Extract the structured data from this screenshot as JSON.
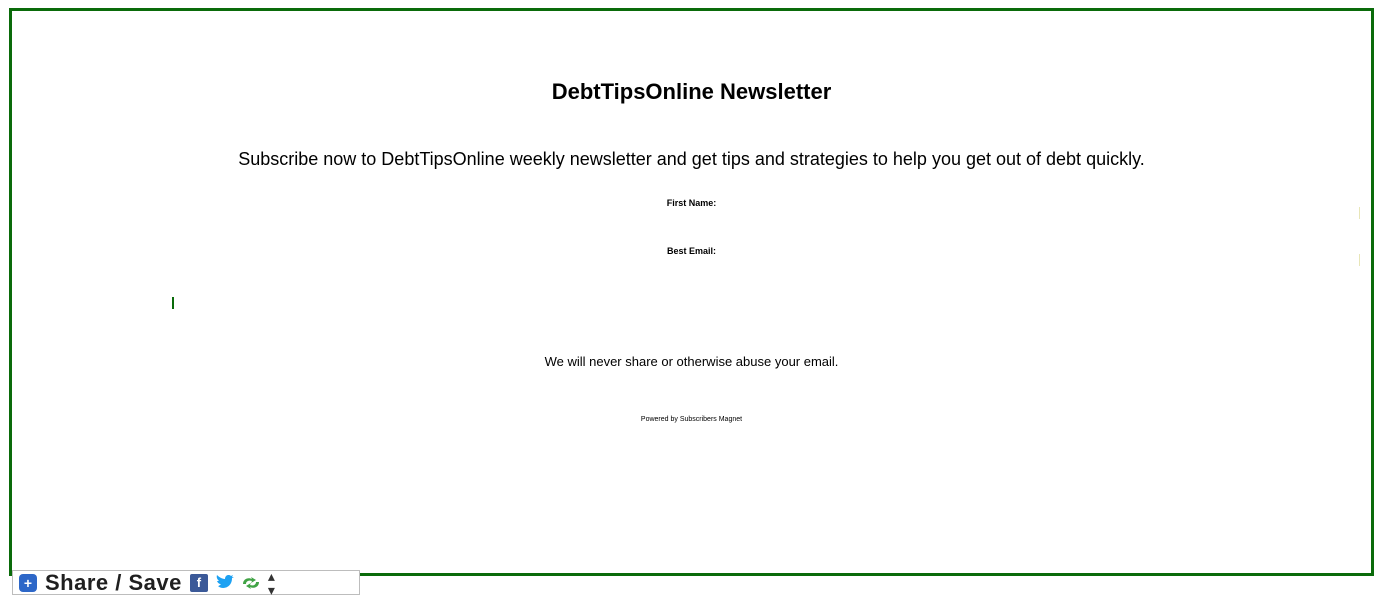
{
  "newsletter": {
    "title": "DebtTipsOnline Newsletter",
    "subtitle": "Subscribe now to DebtTipsOnline weekly newsletter and get tips and strategies to help you get out of debt quickly.",
    "first_name_label": "First Name:",
    "email_label": "Best Email:",
    "notice": "We will never share or otherwise abuse your email.",
    "powered_by": "Powered by Subscribers Magnet"
  },
  "share_bar": {
    "label": "Share / Save",
    "icons": [
      "plus-icon",
      "facebook-icon",
      "twitter-icon",
      "share-icon",
      "up-down-icon"
    ]
  },
  "colors": {
    "frame": "#0a6b0a",
    "share_plus": "#2d67c8",
    "facebook": "#3b5998",
    "twitter": "#1da1f2",
    "share_green": "#41a345"
  }
}
